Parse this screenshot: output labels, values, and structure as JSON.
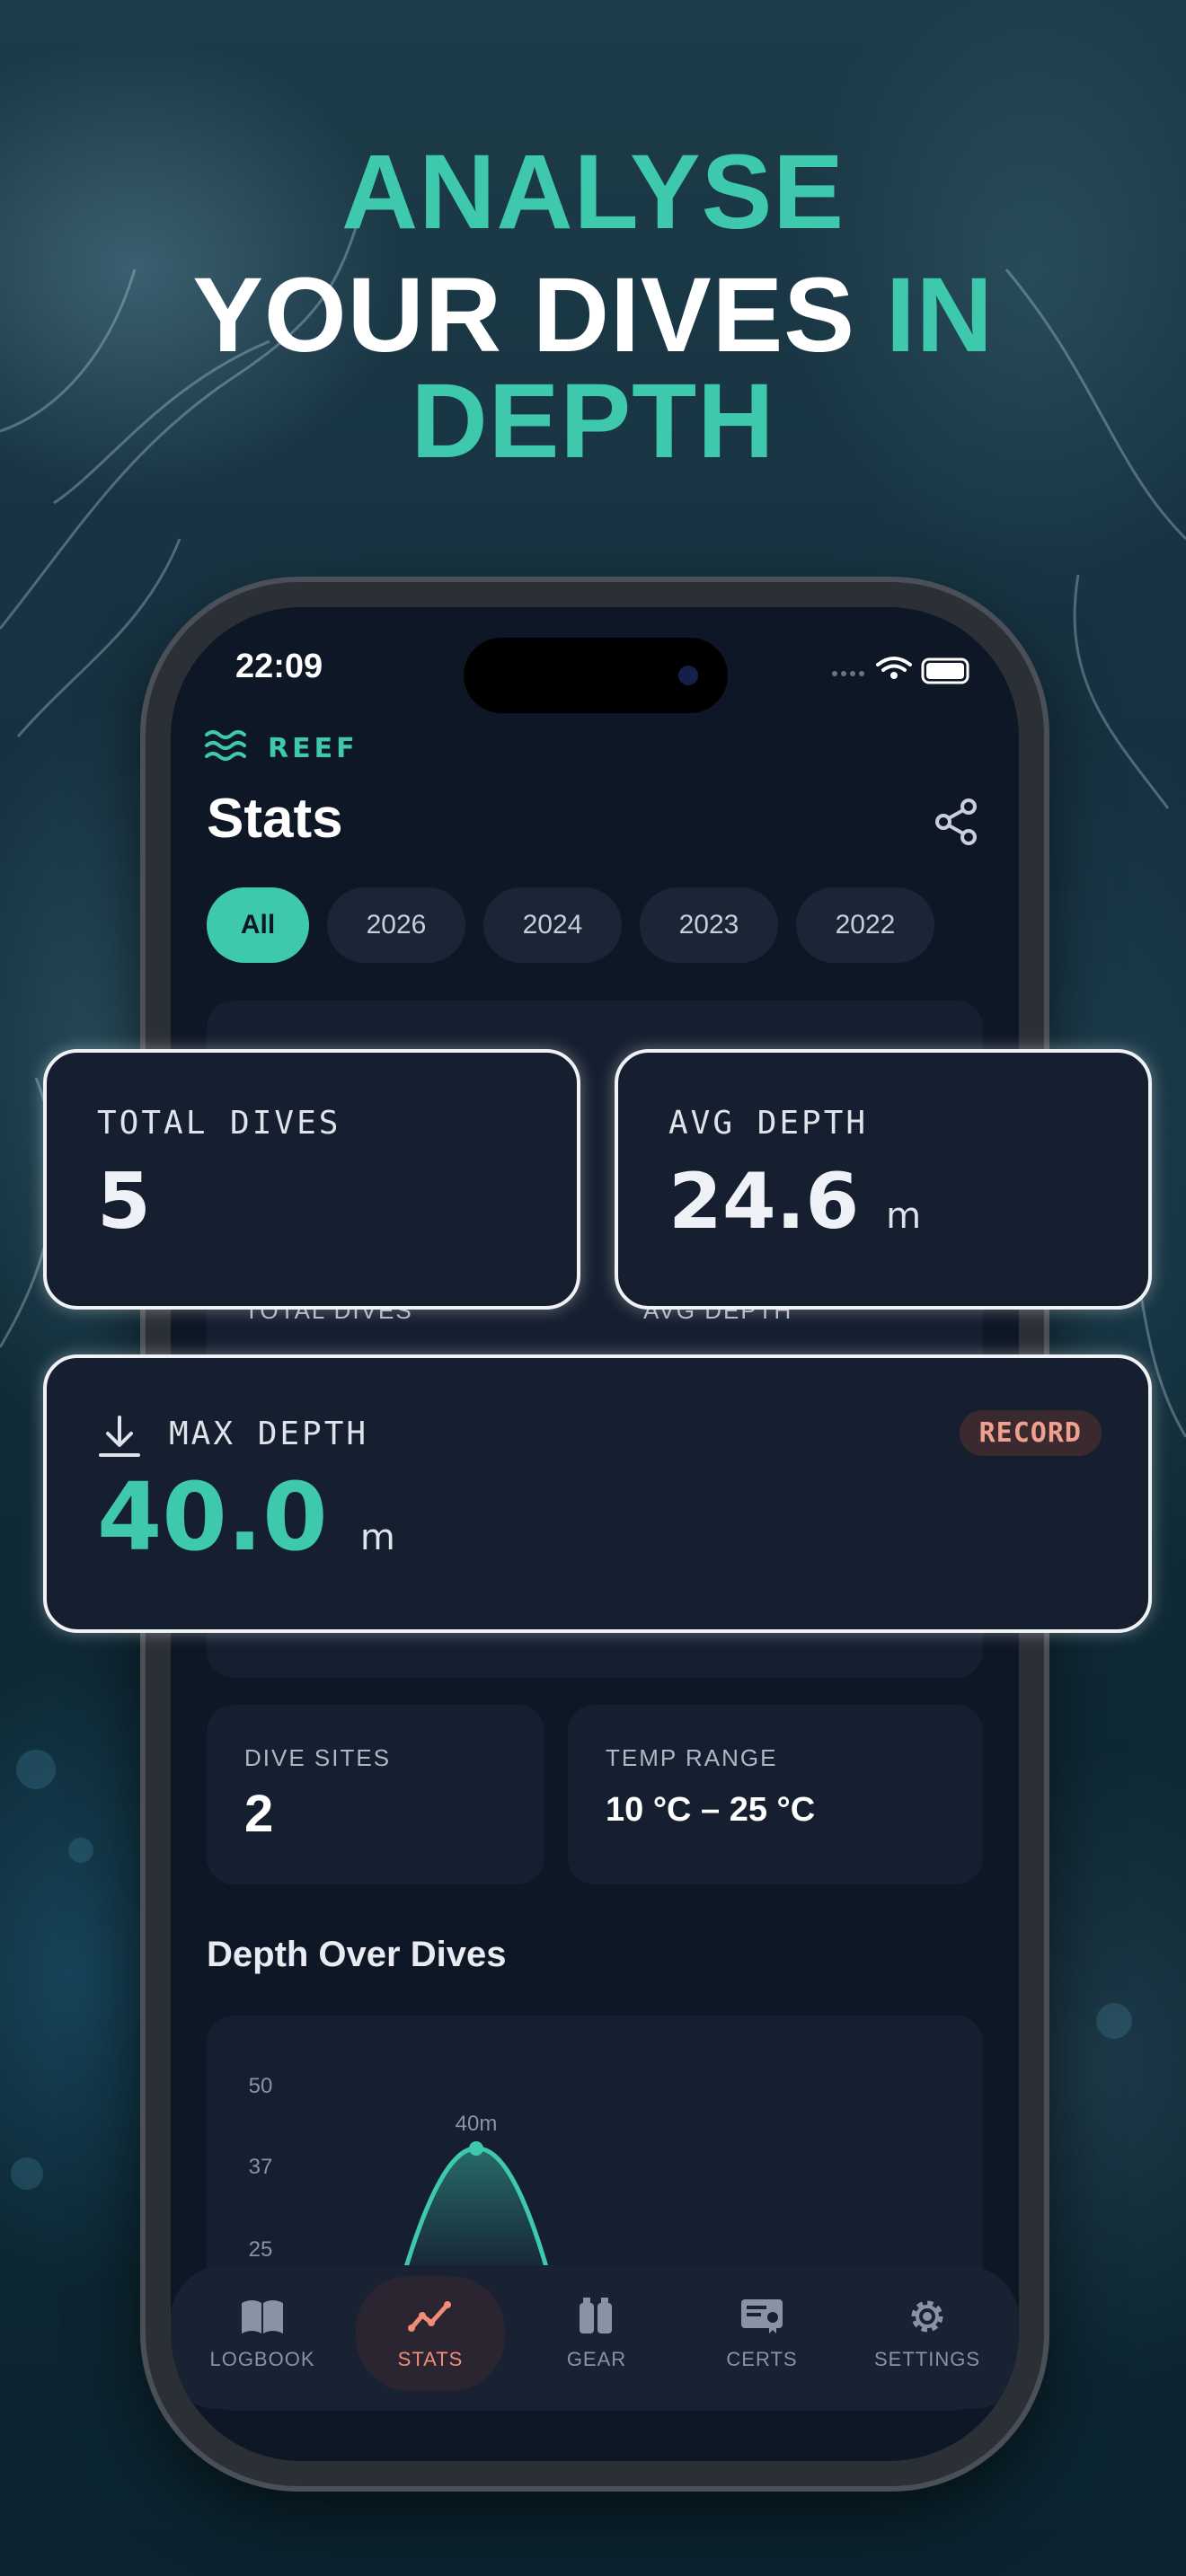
{
  "headline": {
    "line1": "ANALYSE",
    "line2_white": "YOUR DIVES",
    "line2_accent": "IN DEPTH"
  },
  "status_bar": {
    "time": "22:09"
  },
  "app": {
    "brand": "REEF",
    "page_title": "Stats"
  },
  "filters": {
    "chips": [
      "All",
      "2026",
      "2024",
      "2023",
      "2022"
    ],
    "selected": "All"
  },
  "stats": {
    "total_dives": {
      "label": "TOTAL DIVES",
      "value": "5"
    },
    "avg_depth": {
      "label": "AVG DEPTH",
      "value": "24.6",
      "unit": "m"
    },
    "max_depth": {
      "label": "MAX DEPTH",
      "value": "40.0",
      "unit": "m",
      "badge": "RECORD"
    },
    "dive_sites": {
      "label": "DIVE SITES",
      "value": "2"
    },
    "temp_range": {
      "label": "TEMP RANGE",
      "value": "10 °C – 25 °C"
    }
  },
  "chart_section": {
    "title": "Depth Over Dives"
  },
  "chart_data": {
    "type": "area",
    "title": "Depth Over Dives",
    "y_ticks": [
      "50",
      "37",
      "25"
    ],
    "annotations": [
      "40m"
    ],
    "peak_value": 40
  },
  "tabbar": {
    "tabs": [
      {
        "label": "LOGBOOK",
        "icon": "book-icon"
      },
      {
        "label": "STATS",
        "icon": "trend-icon"
      },
      {
        "label": "GEAR",
        "icon": "tank-icon"
      },
      {
        "label": "CERTS",
        "icon": "certificate-icon"
      },
      {
        "label": "SETTINGS",
        "icon": "gear-icon"
      }
    ],
    "active": "STATS"
  },
  "colors": {
    "accent": "#3ec9ad",
    "record": "#f08c78",
    "screen_bg": "#0e1726",
    "panel_bg": "#151f2f"
  }
}
